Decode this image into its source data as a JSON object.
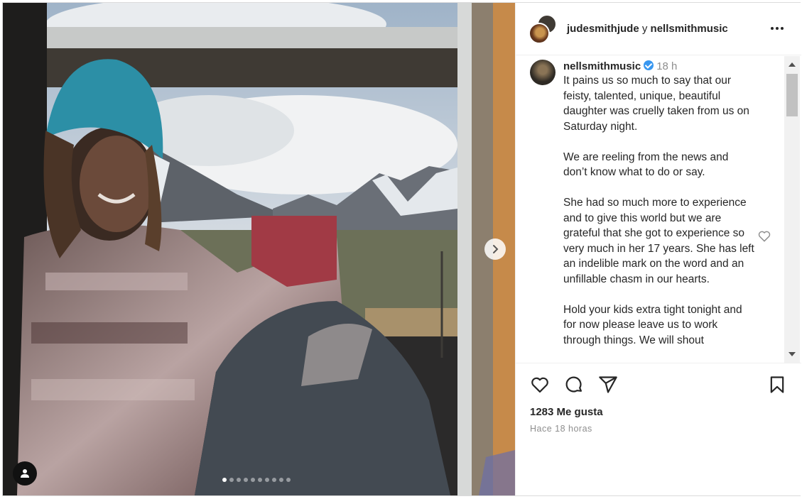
{
  "post": {
    "header": {
      "user_primary": "judesmithjude",
      "conjunction": "y",
      "user_secondary": "nellsmithmusic",
      "more_icon": "more-horizontal-icon"
    },
    "carousel": {
      "slide_count": 10,
      "active_index": 0,
      "next_icon": "chevron-right-icon",
      "tag_icon": "person-icon"
    },
    "comment": {
      "username": "nellsmithmusic",
      "verified": true,
      "time": "18 h",
      "paragraphs": [
        "It pains us so much to say that our feisty, talented, unique, beautiful daughter was cruelly taken from us on Saturday night.",
        "We are reeling from the news and don’t know what to do or say.",
        "She had so much more to experience and to give this world but we are grateful that she got to experience so very much in her 17 years. She has left an indelible mark on the word and an unfillable chasm in our hearts.",
        "Hold your kids extra tight tonight and for now please leave us to work through things. We will shout"
      ]
    },
    "actions": {
      "like_icon": "heart-icon",
      "comment_icon": "comment-icon",
      "share_icon": "send-icon",
      "save_icon": "bookmark-icon"
    },
    "likes_text": "1283 Me gusta",
    "timestamp": "Hace 18 horas",
    "colors": {
      "verified": "#3897f0",
      "text": "#262626",
      "muted": "#8e8e8e",
      "border": "#dbdbdb"
    }
  }
}
